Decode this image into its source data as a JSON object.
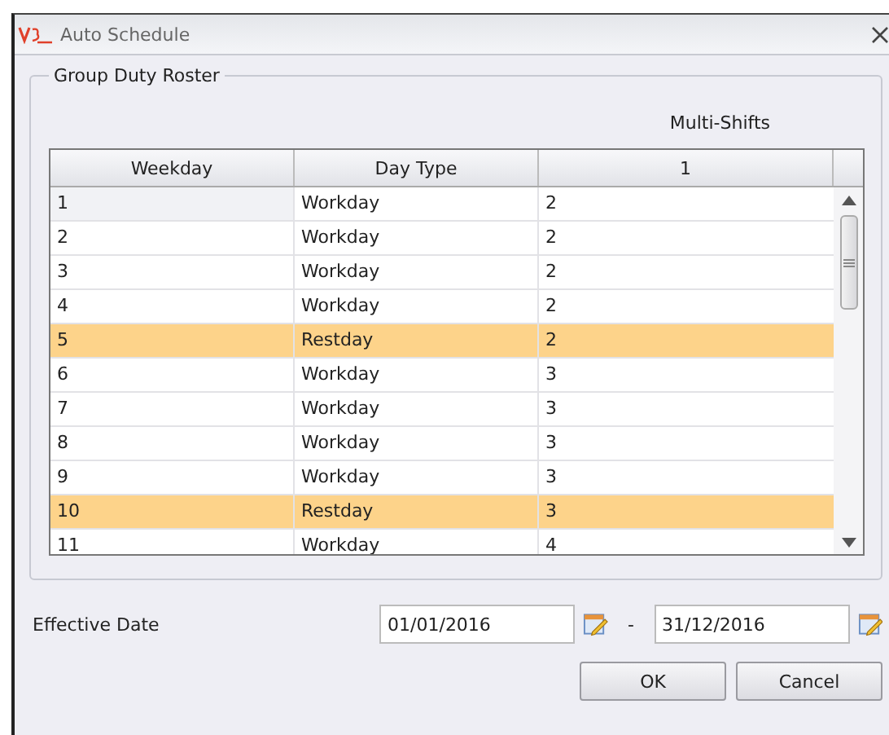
{
  "window": {
    "title": "Auto Schedule"
  },
  "group": {
    "title": "Group Duty Roster",
    "band_header": "Multi-Shifts",
    "table": {
      "columns": [
        "Weekday",
        "Day Type",
        "1"
      ],
      "rows": [
        {
          "cells": [
            "1",
            "Workday",
            "2"
          ],
          "highlighted": false,
          "current": true
        },
        {
          "cells": [
            "2",
            "Workday",
            "2"
          ],
          "highlighted": false,
          "current": false
        },
        {
          "cells": [
            "3",
            "Workday",
            "2"
          ],
          "highlighted": false,
          "current": false
        },
        {
          "cells": [
            "4",
            "Workday",
            "2"
          ],
          "highlighted": false,
          "current": false
        },
        {
          "cells": [
            "5",
            "Restday",
            "2"
          ],
          "highlighted": true,
          "current": false
        },
        {
          "cells": [
            "6",
            "Workday",
            "3"
          ],
          "highlighted": false,
          "current": false
        },
        {
          "cells": [
            "7",
            "Workday",
            "3"
          ],
          "highlighted": false,
          "current": false
        },
        {
          "cells": [
            "8",
            "Workday",
            "3"
          ],
          "highlighted": false,
          "current": false
        },
        {
          "cells": [
            "9",
            "Workday",
            "3"
          ],
          "highlighted": false,
          "current": false
        },
        {
          "cells": [
            "10",
            "Restday",
            "3"
          ],
          "highlighted": true,
          "current": false
        },
        {
          "cells": [
            "11",
            "Workday",
            "4"
          ],
          "highlighted": false,
          "current": false
        }
      ]
    }
  },
  "effective_date": {
    "label": "Effective Date",
    "from": "01/01/2016",
    "separator": "-",
    "to": "31/12/2016"
  },
  "buttons": [
    "OK",
    "Cancel"
  ]
}
